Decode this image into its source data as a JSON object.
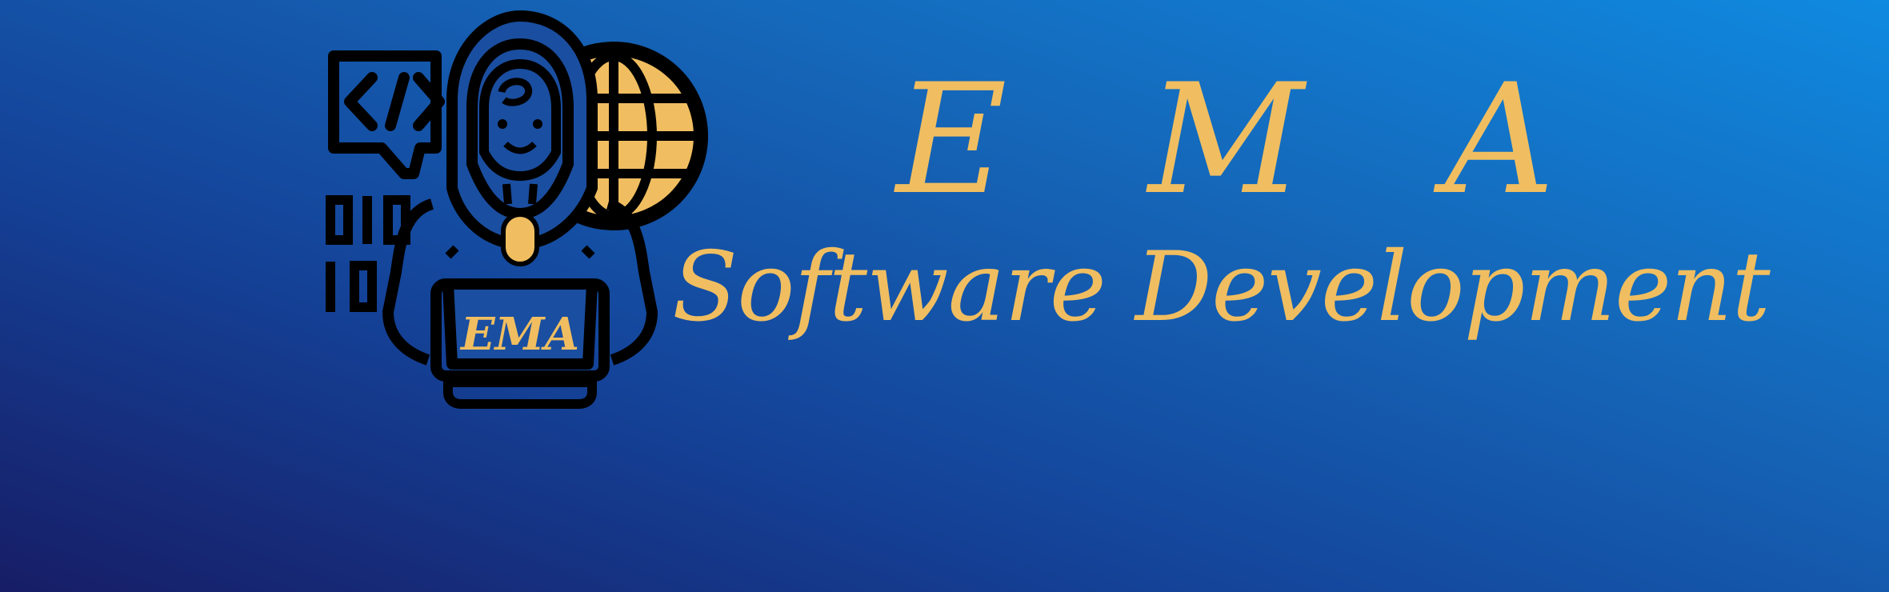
{
  "brand": {
    "title": "E M A",
    "subtitle": "Software Development",
    "laptop_label": "EMA"
  },
  "colors": {
    "accent": "#f0be60",
    "outline": "#000000",
    "background_dark": "#171d66",
    "background_light": "#0f8ae0"
  },
  "icons": {
    "code": "code-bubble-icon",
    "binary": "binary-digits-icon",
    "globe": "globe-icon",
    "developer": "developer-icon",
    "laptop": "laptop-icon"
  }
}
